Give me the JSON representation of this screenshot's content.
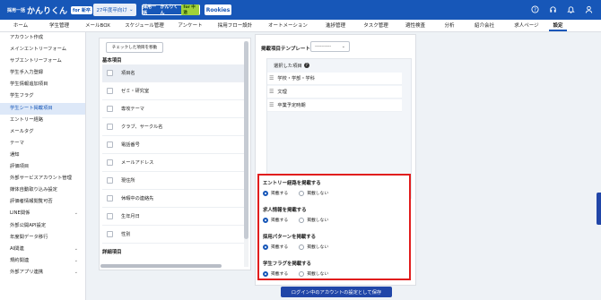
{
  "header": {
    "logo_small": "採用一括",
    "logo_main": "かんりくん",
    "logo_tag": "for 新卒",
    "year_select": "27年度卒向け",
    "product_small": "採用一括",
    "product_main": "かんりくん",
    "product_tag": "for 中途",
    "rookies": "Rookies"
  },
  "nav": {
    "items": [
      "ホーム",
      "学生管理",
      "メールBOX",
      "スケジュール管理",
      "アンケート",
      "採用フロー設計",
      "オートメーション",
      "進捗管理",
      "タスク管理",
      "適性検査",
      "分析",
      "紹介会社",
      "求人ページ",
      "設定"
    ],
    "active": "設定"
  },
  "sidebar": {
    "items": [
      {
        "label": "アカウント作成"
      },
      {
        "label": "メインエントリーフォーム"
      },
      {
        "label": "サブエントリーフォーム"
      },
      {
        "label": "学生手入力登録"
      },
      {
        "label": "学生情報追加項目"
      },
      {
        "label": "学生フラグ"
      },
      {
        "label": "学生シート掲載項目",
        "active": true
      },
      {
        "label": "エントリー経路"
      },
      {
        "label": "メールタグ"
      },
      {
        "label": "テーマ"
      },
      {
        "label": "通知"
      },
      {
        "label": "評価項目"
      },
      {
        "label": "外部サービスアカウント管理"
      },
      {
        "label": "媒体自動取り込み設定"
      },
      {
        "label": "評価者情報閲覧可否"
      },
      {
        "label": "LINE関係",
        "chevron": "⌄"
      },
      {
        "label": "外部公開API設定"
      },
      {
        "label": "年度間データ移行"
      },
      {
        "label": "AI関連",
        "chevron": "⌄"
      },
      {
        "label": "規約関連",
        "chevron": "⌄"
      },
      {
        "label": "外部アプリ連携",
        "chevron": "⌄"
      }
    ]
  },
  "left_panel": {
    "move_button": "チェックした項目を移動",
    "basic_section": "基本項目",
    "items": [
      "項目名",
      "ゼミ・研究室",
      "専攻テーマ",
      "クラブ、サークル名",
      "電話番号",
      "メールアドレス",
      "現住所",
      "休暇中の連絡先",
      "生年月日",
      "性別"
    ],
    "detail_section": "詳細項目"
  },
  "right_panel": {
    "template_label": "掲載項目テンプレート",
    "template_select": "----------",
    "chosen_header": "選択した項目",
    "chosen_items": [
      "学校・学部・学科",
      "文理",
      "卒業予定時期"
    ],
    "options": [
      {
        "title": "エントリー経路を掲載する",
        "yes": "掲載する",
        "no": "掲載しない"
      },
      {
        "title": "求人情報を掲載する",
        "yes": "掲載する",
        "no": "掲載しない"
      },
      {
        "title": "採用パターンを掲載する",
        "yes": "掲載する",
        "no": "掲載しない"
      },
      {
        "title": "学生フラグを掲載する",
        "yes": "掲載する",
        "no": "掲載しない"
      }
    ],
    "save_button": "ログイン中のアカウントの設定として保存"
  },
  "icons": {
    "help": "help-icon",
    "bell": "bell-icon",
    "user": "user-icon",
    "settings": "gear-icon"
  },
  "colors": {
    "brand": "#1757b8",
    "highlight_border": "#e11d1d",
    "button": "#2146a8"
  }
}
